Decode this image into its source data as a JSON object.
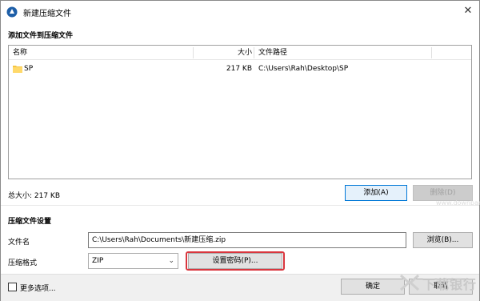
{
  "window": {
    "title": "新建压缩文件",
    "close": "✕"
  },
  "add_section": {
    "heading": "添加文件到压缩文件"
  },
  "file_table": {
    "columns": [
      "名称",
      "大小",
      "文件路径"
    ],
    "rows": [
      {
        "name": "SP",
        "size": "217 KB",
        "path": "C:\\Users\\Rah\\Desktop\\SP",
        "icon": "folder-icon"
      }
    ]
  },
  "total_size": "总大小: 217 KB",
  "buttons": {
    "add": "添加(A)",
    "delete": "删除(D)",
    "browse": "浏览(B)...",
    "set_password": "设置密码(P)...",
    "ok": "确定",
    "cancel": "取消"
  },
  "settings_section": {
    "heading": "压缩文件设置"
  },
  "filename": {
    "label": "文件名",
    "value": "C:\\Users\\Rah\\Documents\\新建压缩.zip"
  },
  "format": {
    "label": "压缩格式",
    "selected": "ZIP"
  },
  "more_options": {
    "label": "更多选项...",
    "checked": false
  },
  "watermark": {
    "text": "下载银行",
    "url": "www.downbank.cn"
  },
  "colors": {
    "accent": "#0078d7",
    "highlight": "#d9363e",
    "folder": "#f5c542"
  }
}
